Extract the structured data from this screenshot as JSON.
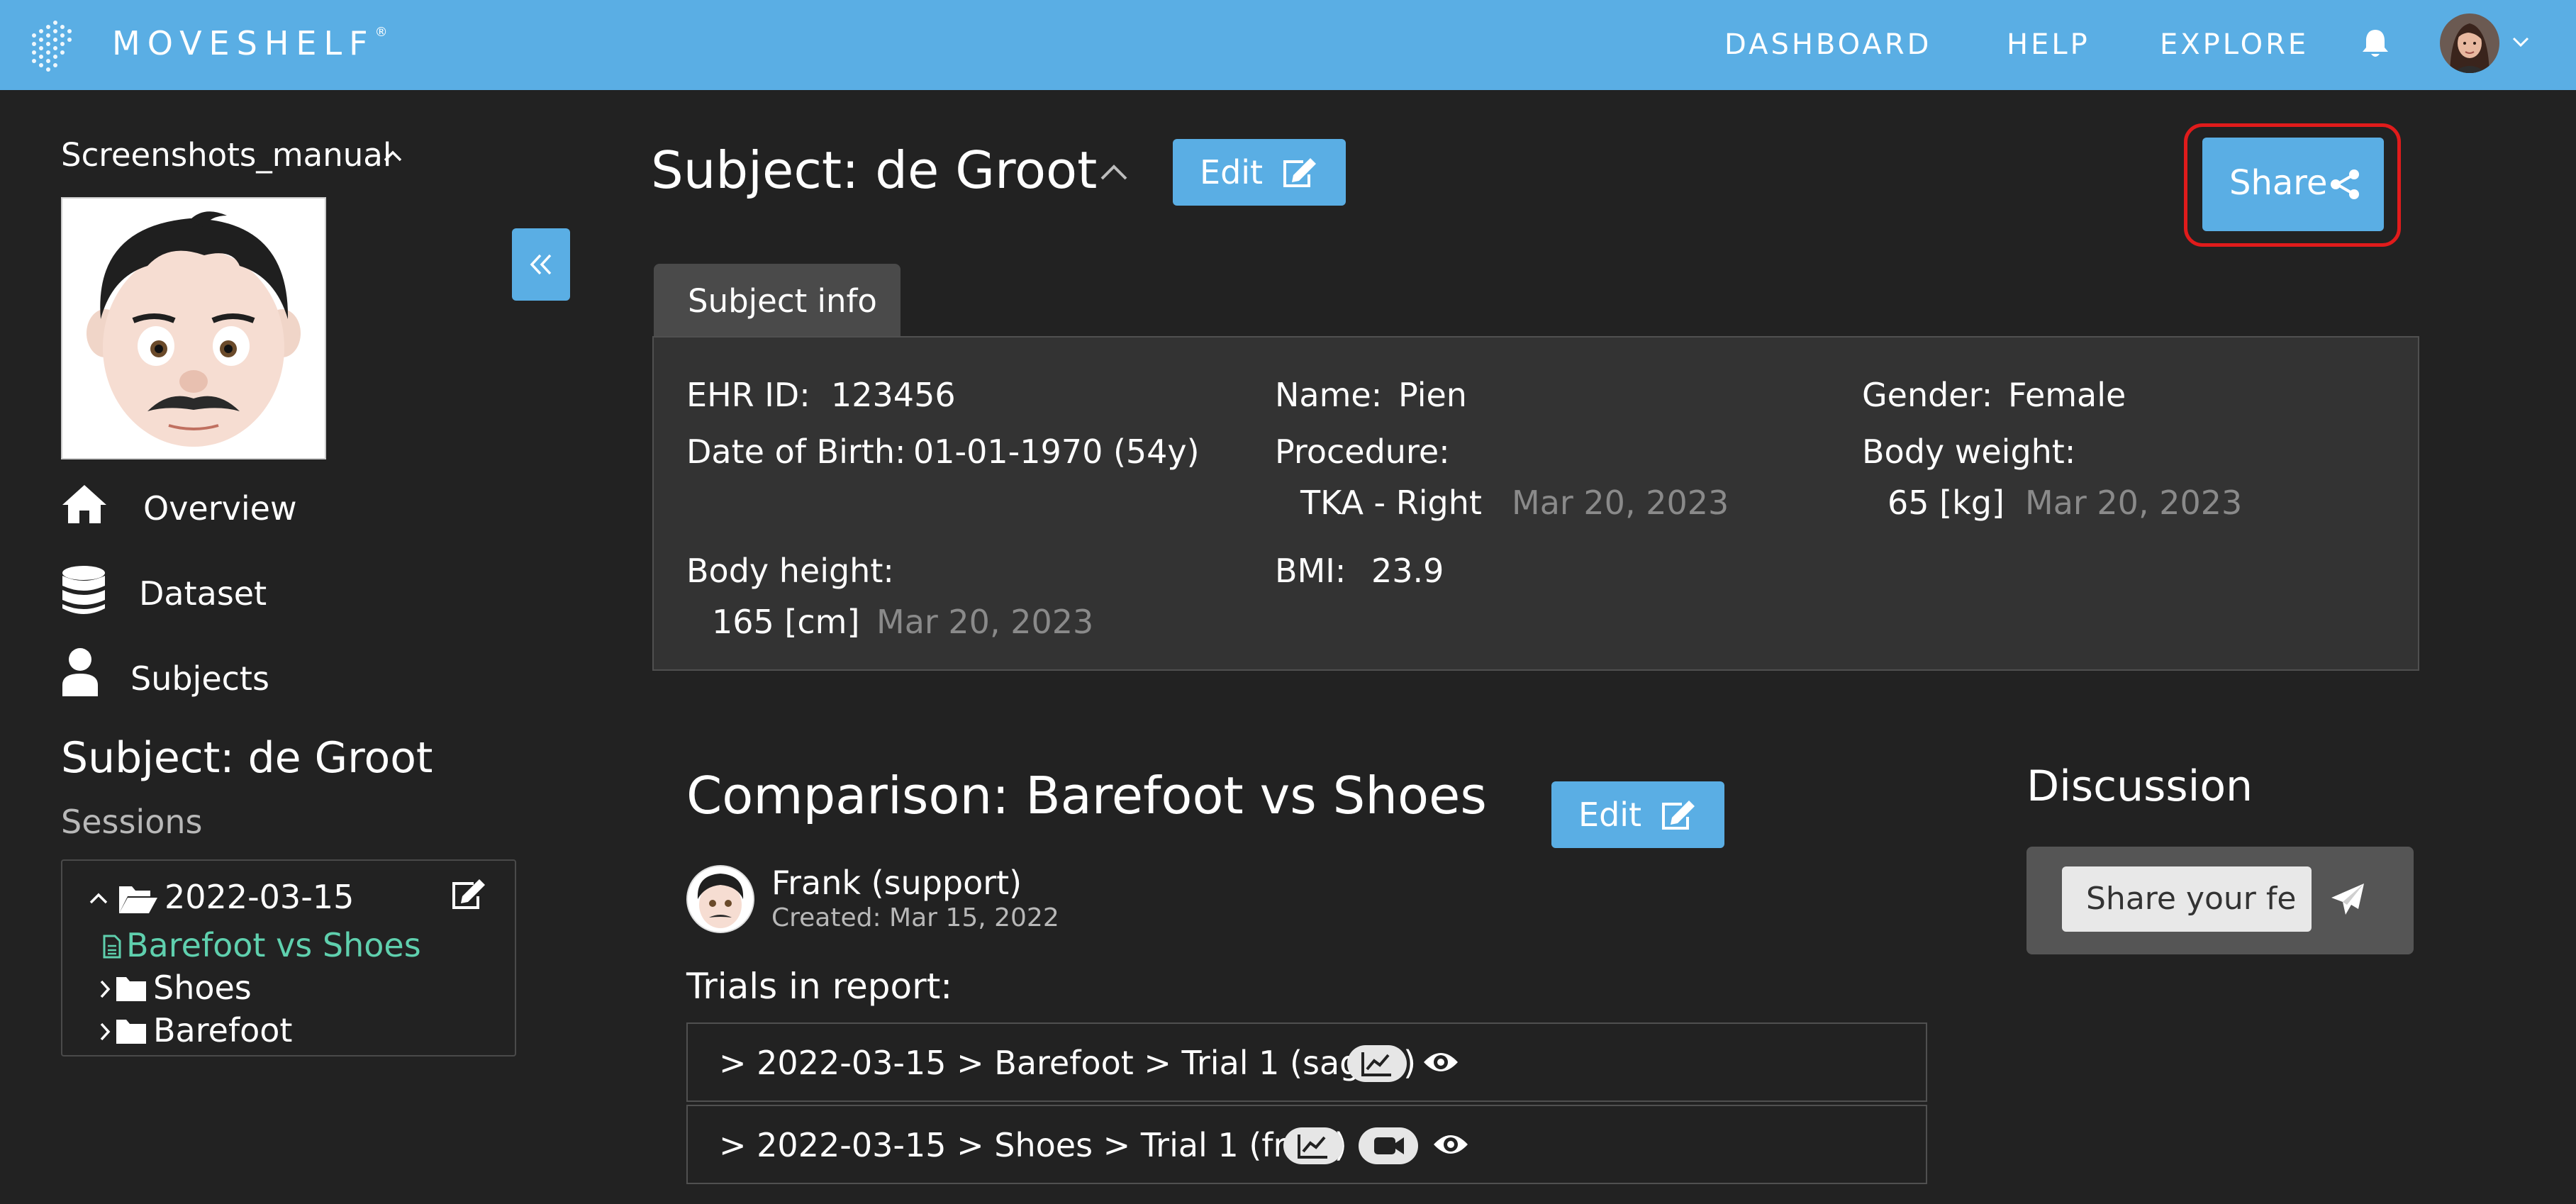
{
  "topbar": {
    "brand": "MOVESHELF",
    "brand_mark": "®",
    "nav": [
      "DASHBOARD",
      "HELP",
      "EXPLORE"
    ],
    "icons": {
      "logo": "hexagon-logo-icon",
      "bell": "bell-icon",
      "chevron": "chevron-down-icon"
    },
    "color": "#5aaee4"
  },
  "sidebar": {
    "project": "Screenshots_manual",
    "items": [
      {
        "label": "Overview",
        "icon": "home-icon"
      },
      {
        "label": "Dataset",
        "icon": "database-icon"
      },
      {
        "label": "Subjects",
        "icon": "user-icon"
      }
    ],
    "subject_heading": "Subject: de Groot",
    "sessions_label": "Sessions",
    "tree": {
      "session": "2022-03-15",
      "report": "Barefoot vs Shoes",
      "folders": [
        "Shoes",
        "Barefoot"
      ]
    }
  },
  "header": {
    "title": "Subject: de Groot",
    "edit_label": "Edit",
    "share_label": "Share"
  },
  "subject_info": {
    "tab_label": "Subject info",
    "ehr_label": "EHR ID:",
    "ehr_value": "123456",
    "name_label": "Name:",
    "name_value": "Pien",
    "gender_label": "Gender:",
    "gender_value": "Female",
    "dob_label": "Date of Birth:",
    "dob_value": "01-01-1970 (54y)",
    "procedure_label": "Procedure:",
    "procedure_value": "TKA - Right",
    "procedure_date": "Mar 20, 2023",
    "weight_label": "Body weight:",
    "weight_value": "65 [kg]",
    "weight_date": "Mar 20, 2023",
    "height_label": "Body height:",
    "height_value": "165 [cm]",
    "height_date": "Mar 20, 2023",
    "bmi_label": "BMI:",
    "bmi_value": "23.9"
  },
  "comparison": {
    "title": "Comparison: Barefoot vs Shoes",
    "edit_label": "Edit",
    "author": "Frank (support)",
    "created": "Created: Mar 15, 2022",
    "trials_label": "Trials in report:",
    "trials": [
      {
        "text": "> 2022-03-15 > Barefoot > Trial 1 (sag re)",
        "icons": [
          "chart-icon",
          "eye-icon"
        ]
      },
      {
        "text": "> 2022-03-15 > Shoes > Trial 1 (fro li)",
        "icons": [
          "chart-icon",
          "video-icon",
          "eye-icon"
        ]
      }
    ]
  },
  "discussion": {
    "title": "Discussion",
    "placeholder": "Share your fe"
  }
}
